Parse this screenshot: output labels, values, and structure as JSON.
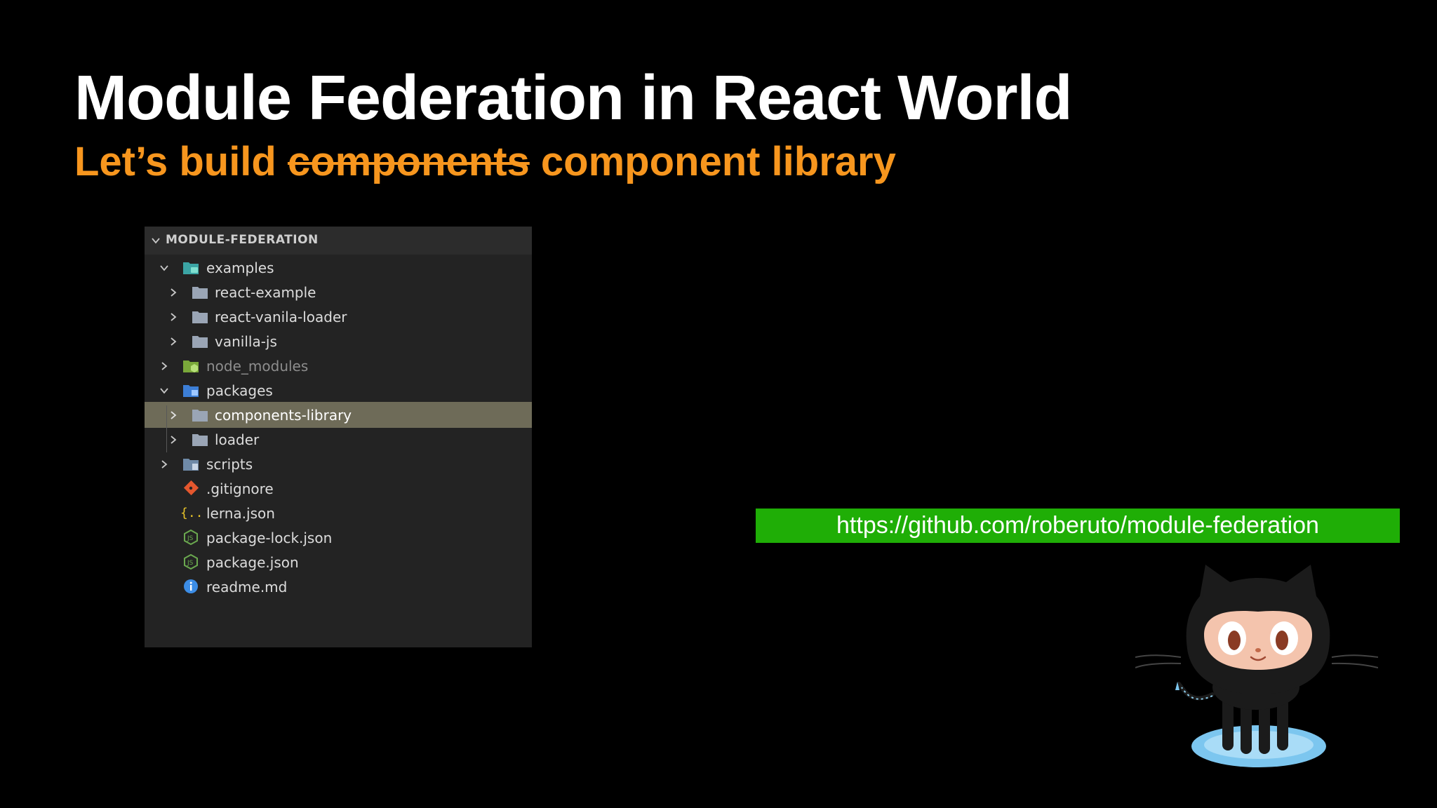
{
  "slide": {
    "title": "Module Federation in React World",
    "subtitle_prefix": "Let’s build ",
    "subtitle_struck": "components",
    "subtitle_suffix": " component library",
    "url": "https://github.com/roberuto/module-federation"
  },
  "explorer": {
    "header": "MODULE-FEDERATION",
    "items": [
      {
        "label": "examples",
        "icon": "folder-examples-icon"
      },
      {
        "label": "react-example",
        "icon": "folder-icon"
      },
      {
        "label": "react-vanila-loader",
        "icon": "folder-icon"
      },
      {
        "label": "vanilla-js",
        "icon": "folder-icon"
      },
      {
        "label": "node_modules",
        "icon": "folder-node-icon"
      },
      {
        "label": "packages",
        "icon": "folder-packages-icon"
      },
      {
        "label": "components-library",
        "icon": "folder-icon"
      },
      {
        "label": "loader",
        "icon": "folder-icon"
      },
      {
        "label": "scripts",
        "icon": "folder-scripts-icon"
      },
      {
        "label": ".gitignore",
        "icon": "git-icon"
      },
      {
        "label": "lerna.json",
        "icon": "json-braces-icon"
      },
      {
        "label": "package-lock.json",
        "icon": "nodejs-icon"
      },
      {
        "label": "package.json",
        "icon": "nodejs-icon"
      },
      {
        "label": "readme.md",
        "icon": "info-icon"
      }
    ]
  },
  "colors": {
    "accent": "#f7961e",
    "url_background": "#1fae06",
    "selected_row": "#6e6b58"
  }
}
